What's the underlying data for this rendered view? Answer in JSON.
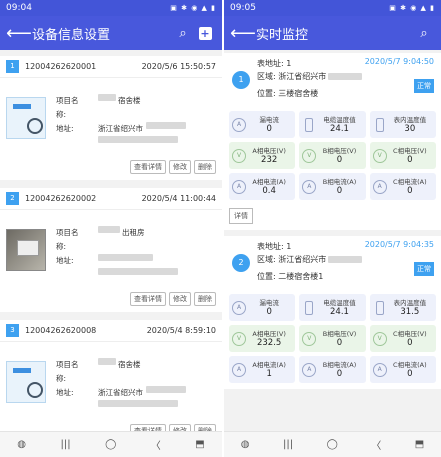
{
  "left": {
    "status_time": "09:04",
    "status_icons": "▣ ✱ ◉ ▲ ▮",
    "title": "设备信息设置",
    "back_glyph": "⟵",
    "search_glyph": "⌕",
    "add_glyph": "+",
    "devices": [
      {
        "index": "1",
        "code": "12004262620001",
        "date": "2020/5/6 15:50:57",
        "name_label": "项目名称:",
        "name_value": "宿舍楼",
        "addr_label": "地址:",
        "addr_value": "浙江省绍兴市"
      },
      {
        "index": "2",
        "code": "12004262620002",
        "date": "2020/5/4 11:00:44",
        "name_label": "项目名称:",
        "name_value": "出租房",
        "addr_label": "地址:",
        "addr_value": ""
      },
      {
        "index": "3",
        "code": "12004262620008",
        "date": "2020/5/4 8:59:10",
        "name_label": "项目名称:",
        "name_value": "宿舍楼",
        "addr_label": "地址:",
        "addr_value": "浙江省绍兴市"
      }
    ],
    "actions": {
      "view": "查看详情",
      "edit": "修改",
      "delete": "删除"
    }
  },
  "right": {
    "status_time": "09:05",
    "status_icons": "▣ ✱ ◉ ▲ ▮",
    "title": "实时监控",
    "back_glyph": "⟵",
    "search_glyph": "⌕",
    "detail_label": "详情",
    "cards": [
      {
        "index": "1",
        "meter": "表地址: 1",
        "region": "区域: 浙江省绍兴市",
        "location": "位置: 三楼宿舍楼",
        "time": "2020/5/7 9:04:50",
        "status": "正常",
        "metrics": [
          {
            "label": "漏电流",
            "value": "0",
            "icon": "A",
            "tone": "blue"
          },
          {
            "label": "电缆温度值",
            "value": "24.1",
            "icon": "thermometer-icon",
            "tone": "blue"
          },
          {
            "label": "表内温度值",
            "value": "30",
            "icon": "thermometer-icon",
            "tone": "blue"
          },
          {
            "label": "A相电压(V)",
            "value": "232",
            "icon": "V",
            "tone": "green"
          },
          {
            "label": "B相电压(V)",
            "value": "0",
            "icon": "V",
            "tone": "green"
          },
          {
            "label": "C相电压(V)",
            "value": "0",
            "icon": "V",
            "tone": "green"
          },
          {
            "label": "A相电流(A)",
            "value": "0.4",
            "icon": "A",
            "tone": "blue"
          },
          {
            "label": "B相电流(A)",
            "value": "0",
            "icon": "A",
            "tone": "blue"
          },
          {
            "label": "C相电流(A)",
            "value": "0",
            "icon": "A",
            "tone": "blue"
          }
        ]
      },
      {
        "index": "2",
        "meter": "表地址: 1",
        "region": "区域: 浙江省绍兴市",
        "location": "位置: 二楼宿舍楼1",
        "time": "2020/5/7 9:04:35",
        "status": "正常",
        "metrics": [
          {
            "label": "漏电流",
            "value": "0",
            "icon": "A",
            "tone": "blue"
          },
          {
            "label": "电缆温度值",
            "value": "24.1",
            "icon": "thermometer-icon",
            "tone": "blue"
          },
          {
            "label": "表内温度值",
            "value": "31.5",
            "icon": "thermometer-icon",
            "tone": "blue"
          },
          {
            "label": "A相电压(V)",
            "value": "232.5",
            "icon": "V",
            "tone": "green"
          },
          {
            "label": "B相电压(V)",
            "value": "0",
            "icon": "V",
            "tone": "green"
          },
          {
            "label": "C相电压(V)",
            "value": "0",
            "icon": "V",
            "tone": "green"
          },
          {
            "label": "A相电流(A)",
            "value": "1",
            "icon": "A",
            "tone": "blue"
          },
          {
            "label": "B相电流(A)",
            "value": "0",
            "icon": "A",
            "tone": "blue"
          },
          {
            "label": "C相电流(A)",
            "value": "0",
            "icon": "A",
            "tone": "blue"
          }
        ]
      }
    ]
  },
  "navbar": {
    "home": "◍",
    "recent": "|||",
    "circle": "◯",
    "back": "〈",
    "assist": "⬒"
  },
  "colors": {
    "appbar": "#4858dc",
    "accent": "#3ea1f0"
  }
}
